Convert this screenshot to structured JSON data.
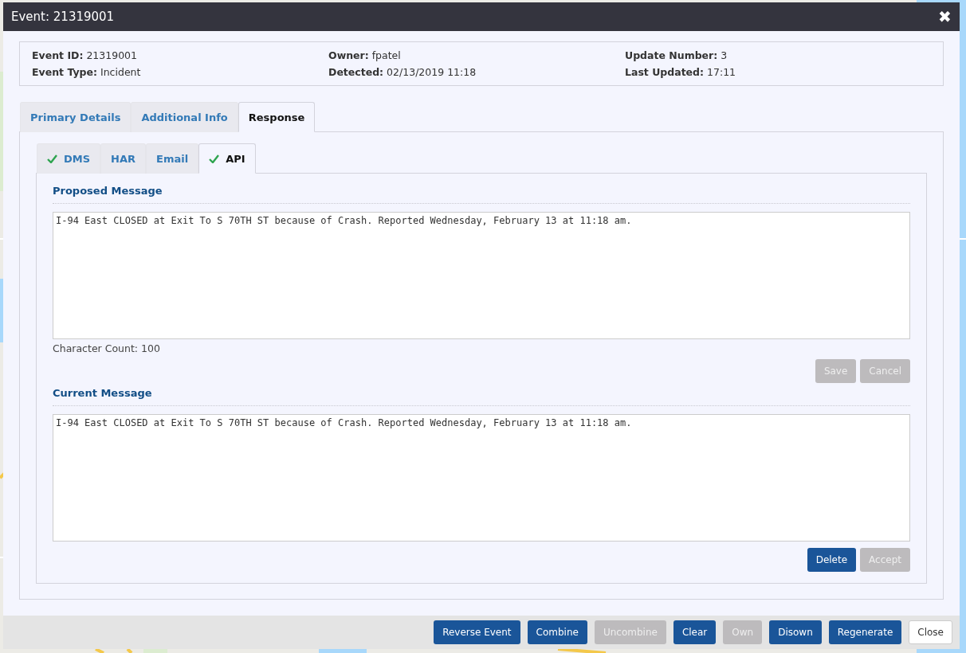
{
  "window": {
    "title": "Event: 21319001",
    "close_glyph": "✖"
  },
  "summary": [
    {
      "label": "Event ID:",
      "value": "21319001"
    },
    {
      "label": "Owner:",
      "value": "fpatel"
    },
    {
      "label": "Update Number:",
      "value": "3"
    },
    {
      "label": "Event Type:",
      "value": "Incident"
    },
    {
      "label": "Detected:",
      "value": "02/13/2019 11:18"
    },
    {
      "label": "Last Updated:",
      "value": "17:11"
    }
  ],
  "tabs": [
    {
      "label": "Primary Details",
      "selected": false
    },
    {
      "label": "Additional Info",
      "selected": false
    },
    {
      "label": "Response",
      "selected": true
    }
  ],
  "subtabs": [
    {
      "label": "DMS",
      "checked": true,
      "selected": false
    },
    {
      "label": "HAR",
      "checked": false,
      "selected": false
    },
    {
      "label": "Email",
      "checked": false,
      "selected": false
    },
    {
      "label": "API",
      "checked": true,
      "selected": true
    }
  ],
  "proposed": {
    "heading": "Proposed Message",
    "value": "I-94 East CLOSED at Exit To S 70TH ST because of Crash. Reported Wednesday, February 13 at 11:18 am.",
    "count": "Character Count: 100",
    "buttons": [
      {
        "label": "Save",
        "disabled": true
      },
      {
        "label": "Cancel",
        "disabled": true
      }
    ]
  },
  "current": {
    "heading": "Current Message",
    "value": "I-94 East CLOSED at Exit To S 70TH ST because of Crash. Reported Wednesday, February 13 at 11:18 am.",
    "buttons": [
      {
        "label": "Delete",
        "disabled": false
      },
      {
        "label": "Accept",
        "disabled": true
      }
    ]
  },
  "footer_buttons": [
    {
      "label": "Reverse Event",
      "kind": "primary",
      "disabled": false
    },
    {
      "label": "Combine",
      "kind": "primary",
      "disabled": false
    },
    {
      "label": "Uncombine",
      "kind": "primary",
      "disabled": true
    },
    {
      "label": "Clear",
      "kind": "primary",
      "disabled": false
    },
    {
      "label": "Own",
      "kind": "primary",
      "disabled": true
    },
    {
      "label": "Disown",
      "kind": "primary",
      "disabled": false
    },
    {
      "label": "Regenerate",
      "kind": "primary",
      "disabled": false
    },
    {
      "label": "Close",
      "kind": "default",
      "disabled": false
    }
  ]
}
